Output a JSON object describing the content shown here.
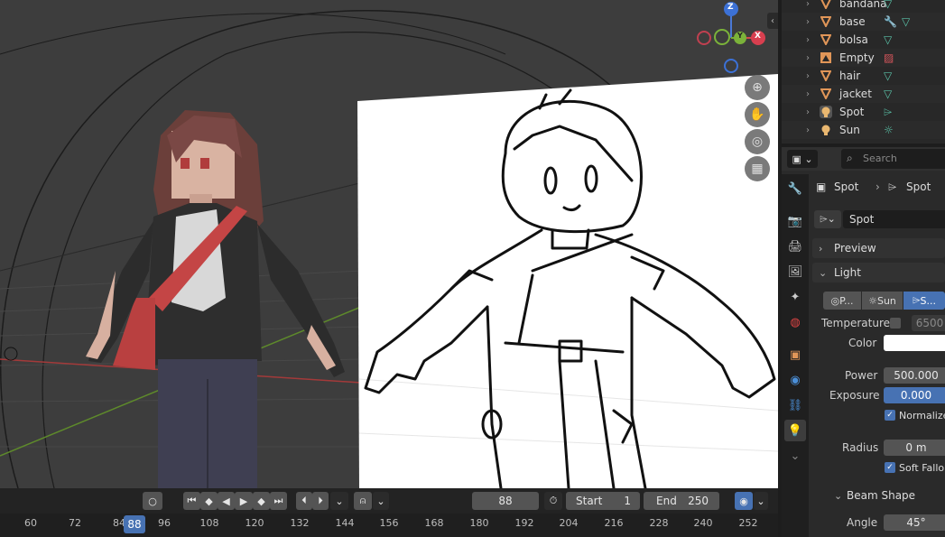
{
  "viewport": {
    "nav_gizmo": {
      "z_label": "Z",
      "x_label": "X",
      "y_label": "Y"
    },
    "tools": [
      "zoom-icon",
      "hand-pan-icon",
      "camera-view-icon",
      "grid-perspective-icon"
    ]
  },
  "timeline": {
    "current_frame": "88",
    "start_label": "Start",
    "start_value": "1",
    "end_label": "End",
    "end_value": "250",
    "ruler_ticks": [
      "60",
      "72",
      "84",
      "96",
      "108",
      "120",
      "132",
      "144",
      "156",
      "168",
      "180",
      "192",
      "204",
      "216",
      "228",
      "240",
      "252"
    ],
    "marker": "88"
  },
  "outliner": {
    "items": [
      {
        "label": "bandana",
        "type": "mesh"
      },
      {
        "label": "base",
        "type": "mesh"
      },
      {
        "label": "bolsa",
        "type": "mesh"
      },
      {
        "label": "Empty",
        "type": "empty"
      },
      {
        "label": "hair",
        "type": "mesh"
      },
      {
        "label": "jacket",
        "type": "mesh"
      },
      {
        "label": "Spot",
        "type": "light"
      },
      {
        "label": "Sun",
        "type": "light"
      }
    ]
  },
  "properties": {
    "search_placeholder": "Search",
    "breadcrumb": {
      "object": "Spot",
      "data": "Spot"
    },
    "datablock_name": "Spot",
    "preview_label": "Preview",
    "light_label": "Light",
    "light_types": [
      "P...",
      "Sun",
      "S..."
    ],
    "temperature_label": "Temperature",
    "temperature_value": "6500",
    "color_label": "Color",
    "power_label": "Power",
    "power_value": "500.000",
    "exposure_label": "Exposure",
    "exposure_value": "0.000",
    "normalize_label": "Normalize",
    "radius_label": "Radius",
    "radius_value": "0 m",
    "soft_falloff_label": "Soft Fallo",
    "beam_shape_label": "Beam Shape",
    "angle_label": "Angle",
    "angle_value": "45°"
  },
  "colors": {
    "accent": "#4772b3",
    "mesh_icon": "#e19658",
    "mesh_data": "#5ac2a8",
    "light_icon": "#e9b770"
  }
}
